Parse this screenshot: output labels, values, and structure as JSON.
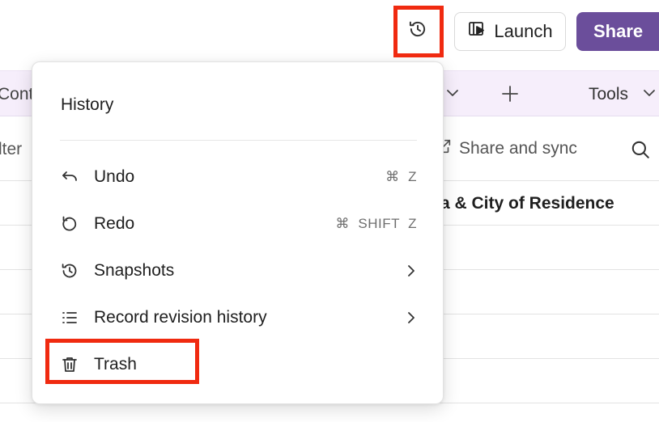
{
  "topbar": {
    "history_icon": "history-icon",
    "launch_label": "Launch",
    "launch_icon": "launch-icon",
    "share_label": "Share"
  },
  "viewbar": {
    "partial_label": "Cont",
    "add_icon": "plus-icon",
    "tools_label": "Tools"
  },
  "toolbar": {
    "partial_filter_label": "lter",
    "share_sync_label": "Share and sync",
    "search_icon": "search-icon"
  },
  "grid": {
    "visible_column_header": "a & City of Residence"
  },
  "history_menu": {
    "title": "History",
    "items": [
      {
        "label": "Undo",
        "icon": "undo-icon",
        "shortcut": "⌘  Z"
      },
      {
        "label": "Redo",
        "icon": "redo-icon",
        "shortcut": "⌘  SHIFT  Z"
      },
      {
        "label": "Snapshots",
        "icon": "snapshot-icon",
        "submenu": true
      },
      {
        "label": "Record revision history",
        "icon": "list-icon",
        "submenu": true
      },
      {
        "label": "Trash",
        "icon": "trash-icon"
      }
    ]
  },
  "colors": {
    "accent": "#6b4e9b",
    "viewbar_bg": "#f6eefb",
    "highlight": "#f02a10"
  }
}
